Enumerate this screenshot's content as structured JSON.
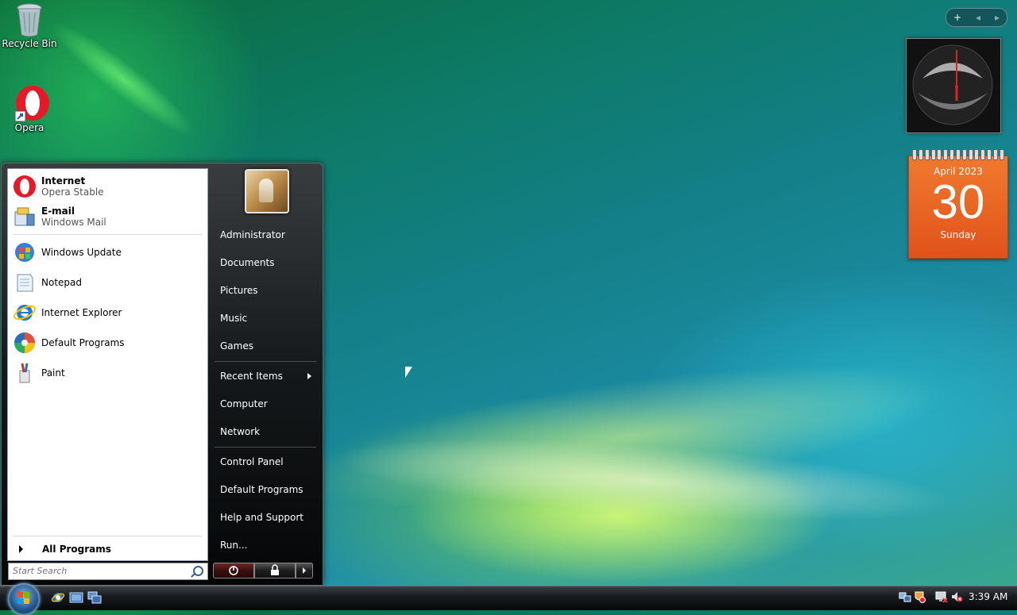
{
  "desktop": {
    "icons": [
      {
        "label": "Recycle Bin",
        "icon": "recycle-bin-icon"
      },
      {
        "label": "Opera",
        "icon": "opera-icon"
      }
    ]
  },
  "gadgets": {
    "sidebar_controls": {
      "add": "+",
      "prev": "◂",
      "next": "▸"
    },
    "calendar": {
      "month_year": "April 2023",
      "day": "30",
      "weekday": "Sunday"
    }
  },
  "start_menu": {
    "pinned": [
      {
        "title": "Internet",
        "subtitle": "Opera Stable",
        "icon": "opera-icon"
      },
      {
        "title": "E-mail",
        "subtitle": "Windows Mail",
        "icon": "windows-mail-icon"
      }
    ],
    "recent": [
      {
        "label": "Windows Update",
        "icon": "windows-update-icon"
      },
      {
        "label": "Notepad",
        "icon": "notepad-icon"
      },
      {
        "label": "Internet Explorer",
        "icon": "internet-explorer-icon"
      },
      {
        "label": "Default Programs",
        "icon": "default-programs-icon"
      },
      {
        "label": "Paint",
        "icon": "paint-icon"
      }
    ],
    "all_programs": "All Programs",
    "search_placeholder": "Start Search",
    "right_items": [
      "Administrator",
      "Documents",
      "Pictures",
      "Music",
      "Games",
      "Recent Items",
      "Computer",
      "Network",
      "Control Panel",
      "Default Programs",
      "Help and Support",
      "Run..."
    ]
  },
  "taskbar": {
    "quick_launch": [
      "internet-explorer-icon",
      "show-desktop-icon",
      "switch-windows-icon"
    ],
    "tray_icons": [
      "network-icon",
      "security-alert-icon",
      "monitor-icon",
      "volume-muted-icon"
    ],
    "clock": "3:39 AM"
  },
  "colors": {
    "calendar_orange": "#e8601f",
    "start_menu_dark": "#15181a",
    "taskbar_dark": "#1a1d20"
  }
}
